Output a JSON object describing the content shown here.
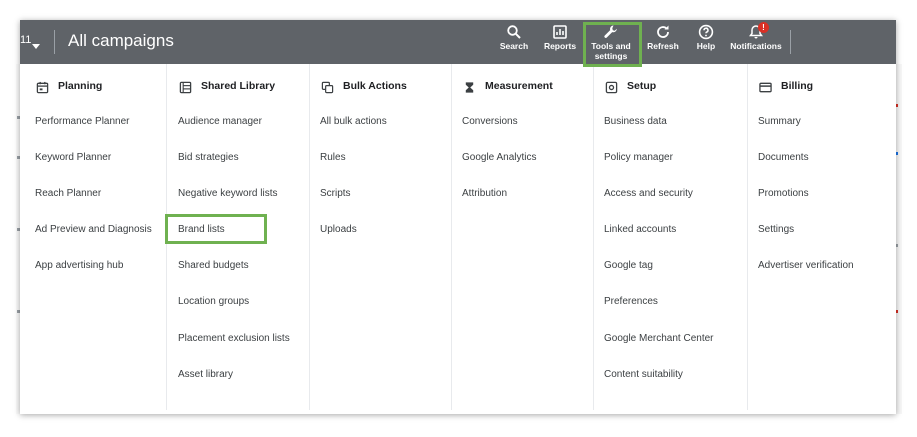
{
  "topbar": {
    "account_fragment": "11",
    "title": "All campaigns",
    "items": [
      {
        "label": "Search",
        "icon": "search-icon"
      },
      {
        "label": "Reports",
        "icon": "reports-icon"
      },
      {
        "label_line1": "Tools and",
        "label_line2": "settings",
        "icon": "wrench-icon"
      },
      {
        "label": "Refresh",
        "icon": "refresh-icon"
      },
      {
        "label": "Help",
        "icon": "help-icon"
      },
      {
        "label": "Notifications",
        "icon": "bell-icon",
        "badge": "!"
      }
    ]
  },
  "menu": {
    "columns": [
      {
        "heading": "Planning",
        "icon": "calendar-icon",
        "items": [
          "Performance Planner",
          "Keyword Planner",
          "Reach Planner",
          "Ad Preview and Diagnosis",
          "App advertising hub"
        ]
      },
      {
        "heading": "Shared Library",
        "icon": "library-icon",
        "items": [
          "Audience manager",
          "Bid strategies",
          "Negative keyword lists",
          "Brand lists",
          "Shared budgets",
          "Location groups",
          "Placement exclusion lists",
          "Asset library"
        ]
      },
      {
        "heading": "Bulk Actions",
        "icon": "copy-icon",
        "items": [
          "All bulk actions",
          "Rules",
          "Scripts",
          "Uploads"
        ]
      },
      {
        "heading": "Measurement",
        "icon": "hourglass-icon",
        "items": [
          "Conversions",
          "Google Analytics",
          "Attribution"
        ]
      },
      {
        "heading": "Setup",
        "icon": "setup-icon",
        "items": [
          "Business data",
          "Policy manager",
          "Access and security",
          "Linked accounts",
          "Google tag",
          "Preferences",
          "Google Merchant Center",
          "Content suitability"
        ]
      },
      {
        "heading": "Billing",
        "icon": "credit-card-icon",
        "items": [
          "Summary",
          "Documents",
          "Promotions",
          "Settings",
          "Advertiser verification"
        ]
      }
    ]
  },
  "colors": {
    "topbar_bg": "#5f6368",
    "highlight": "#6fb150",
    "badge": "#d93025",
    "text": "#3c4043"
  }
}
